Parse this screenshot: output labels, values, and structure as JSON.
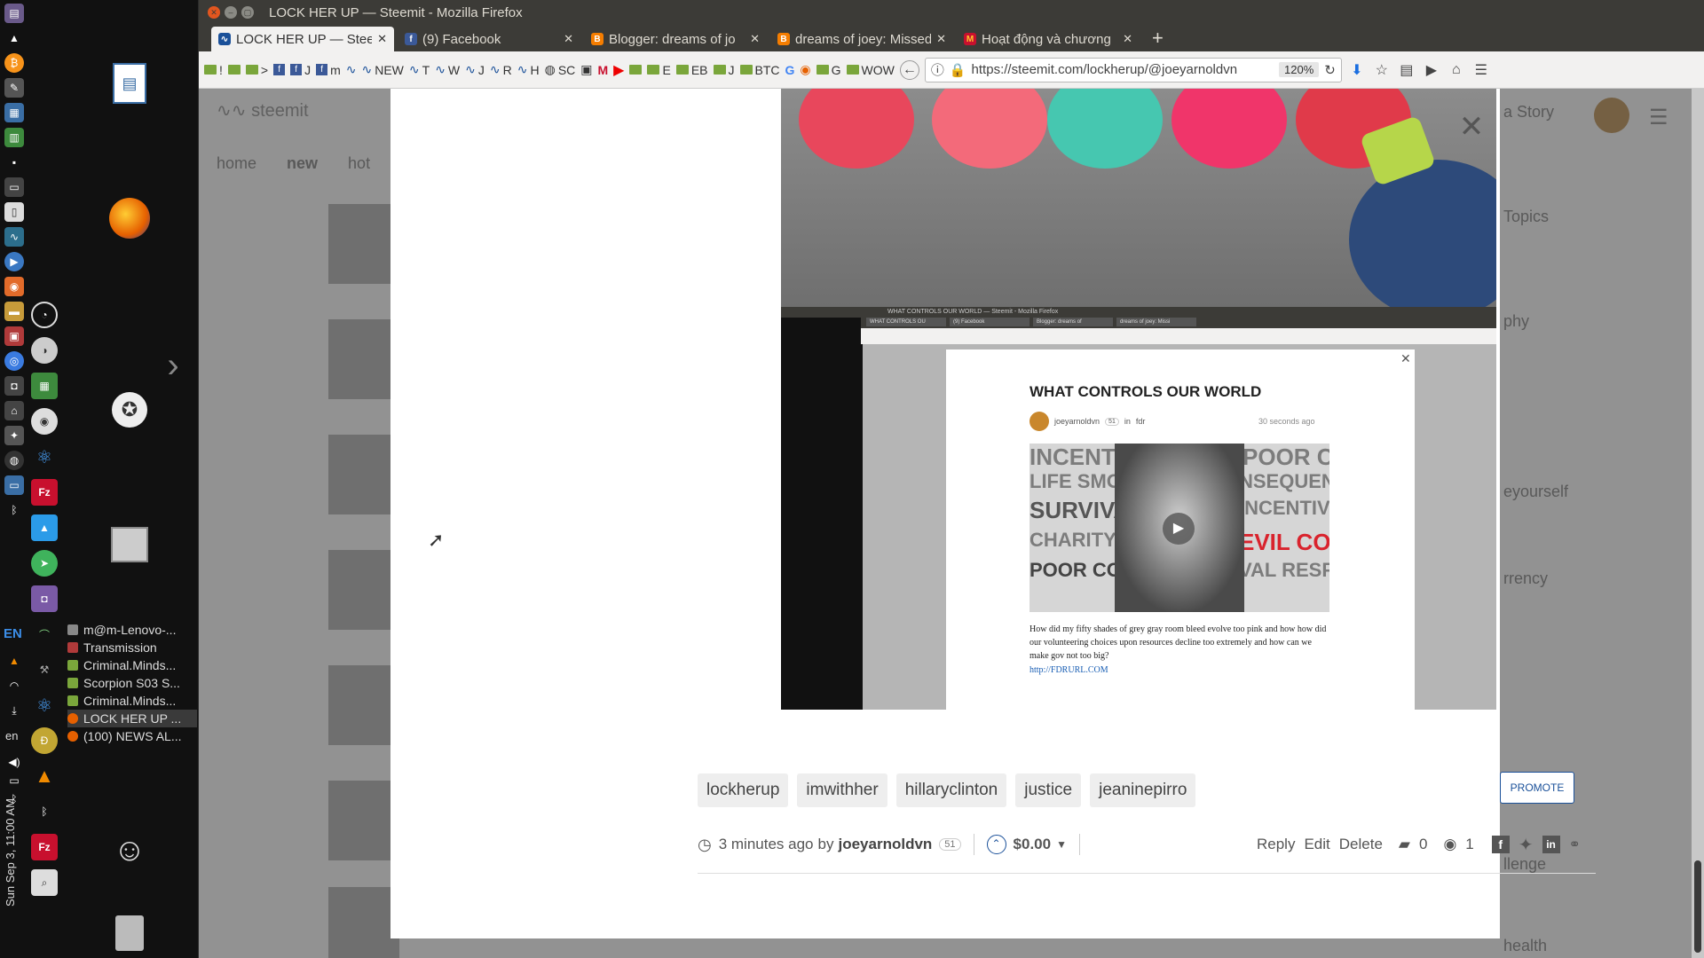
{
  "window": {
    "title": "LOCK HER UP — Steemit - Mozilla Firefox"
  },
  "tabs": [
    {
      "label": "LOCK HER UP — Steem",
      "icon": "steemit-icon",
      "active": true
    },
    {
      "label": "(9) Facebook",
      "icon": "facebook-icon",
      "active": false
    },
    {
      "label": "Blogger: dreams of jo",
      "icon": "blogger-icon",
      "active": false
    },
    {
      "label": "dreams of joey: Missed",
      "icon": "blogger-icon",
      "active": false
    },
    {
      "label": "Hoạt động và chương",
      "icon": "mcdonalds-icon",
      "active": false
    }
  ],
  "bookmarks": [
    "!",
    ">",
    "J",
    "m",
    "NEW",
    "T",
    "W",
    "J",
    "R",
    "H",
    "SC",
    "E",
    "EB",
    "J",
    "BTC",
    "G",
    "G",
    "WOW"
  ],
  "urlbar": {
    "url": "https://steemit.com/lockherup/@joeyarnoldvn",
    "zoom": "120%"
  },
  "launcher": {
    "tasks": [
      "m@m-Lenovo-...",
      "Transmission",
      "Criminal.Minds...",
      "Scorpion S03 S...",
      "Criminal.Minds...",
      "LOCK HER UP ...",
      "(100) NEWS AL..."
    ],
    "lang": "EN",
    "lang2": "en",
    "clock": "Sun Sep 3, 11:00 AM"
  },
  "background_page": {
    "logo": "steemit",
    "nav": [
      "home",
      "new",
      "hot"
    ],
    "sidebar": [
      "a Story",
      "Topics",
      "phy",
      "eyourself",
      "rrency",
      "llenge",
      "health"
    ]
  },
  "nested_post": {
    "window_title": "WHAT CONTROLS OUR WORLD — Steemit - Mozilla Firefox",
    "tabs": [
      "WHAT CONTROLS OU",
      "(9) Facebook",
      "Blogger: dreams of",
      "dreams of joey: Missi"
    ],
    "title": "WHAT CONTROLS OUR WORLD",
    "author": "joeyarnoldvn",
    "reputation": "51",
    "category_prefix": "in",
    "category": "fdr",
    "time": "30 seconds ago",
    "image_words": [
      "INCENTIVES",
      "POOR C",
      "LIFE SMO",
      "NSEQUENC",
      "SURVIVAL",
      "INCENTIVE",
      "CHARITY LI",
      "EVIL CON",
      "POOR CONSE",
      "VAL RESPO"
    ],
    "body": "How did my fifty shades of grey gray room bleed evolve too pink and how how did our volunteering choices upon resources decline too extremely and how can we make gov not too big?",
    "link": "http://FDRURL.COM"
  },
  "tags": [
    "lockherup",
    "imwithher",
    "hillaryclinton",
    "justice",
    "jeaninepirro"
  ],
  "promote_label": "PROMOTE",
  "footer": {
    "time": "3 minutes ago",
    "by": "by",
    "author": "joeyarnoldvn",
    "reputation": "51",
    "payout": "$0.00",
    "reply": "Reply",
    "edit": "Edit",
    "delete": "Delete",
    "comments": "0",
    "views": "1"
  },
  "colors": {
    "accent": "#1a5099",
    "ubuntu_bar": "#3c3b37"
  }
}
